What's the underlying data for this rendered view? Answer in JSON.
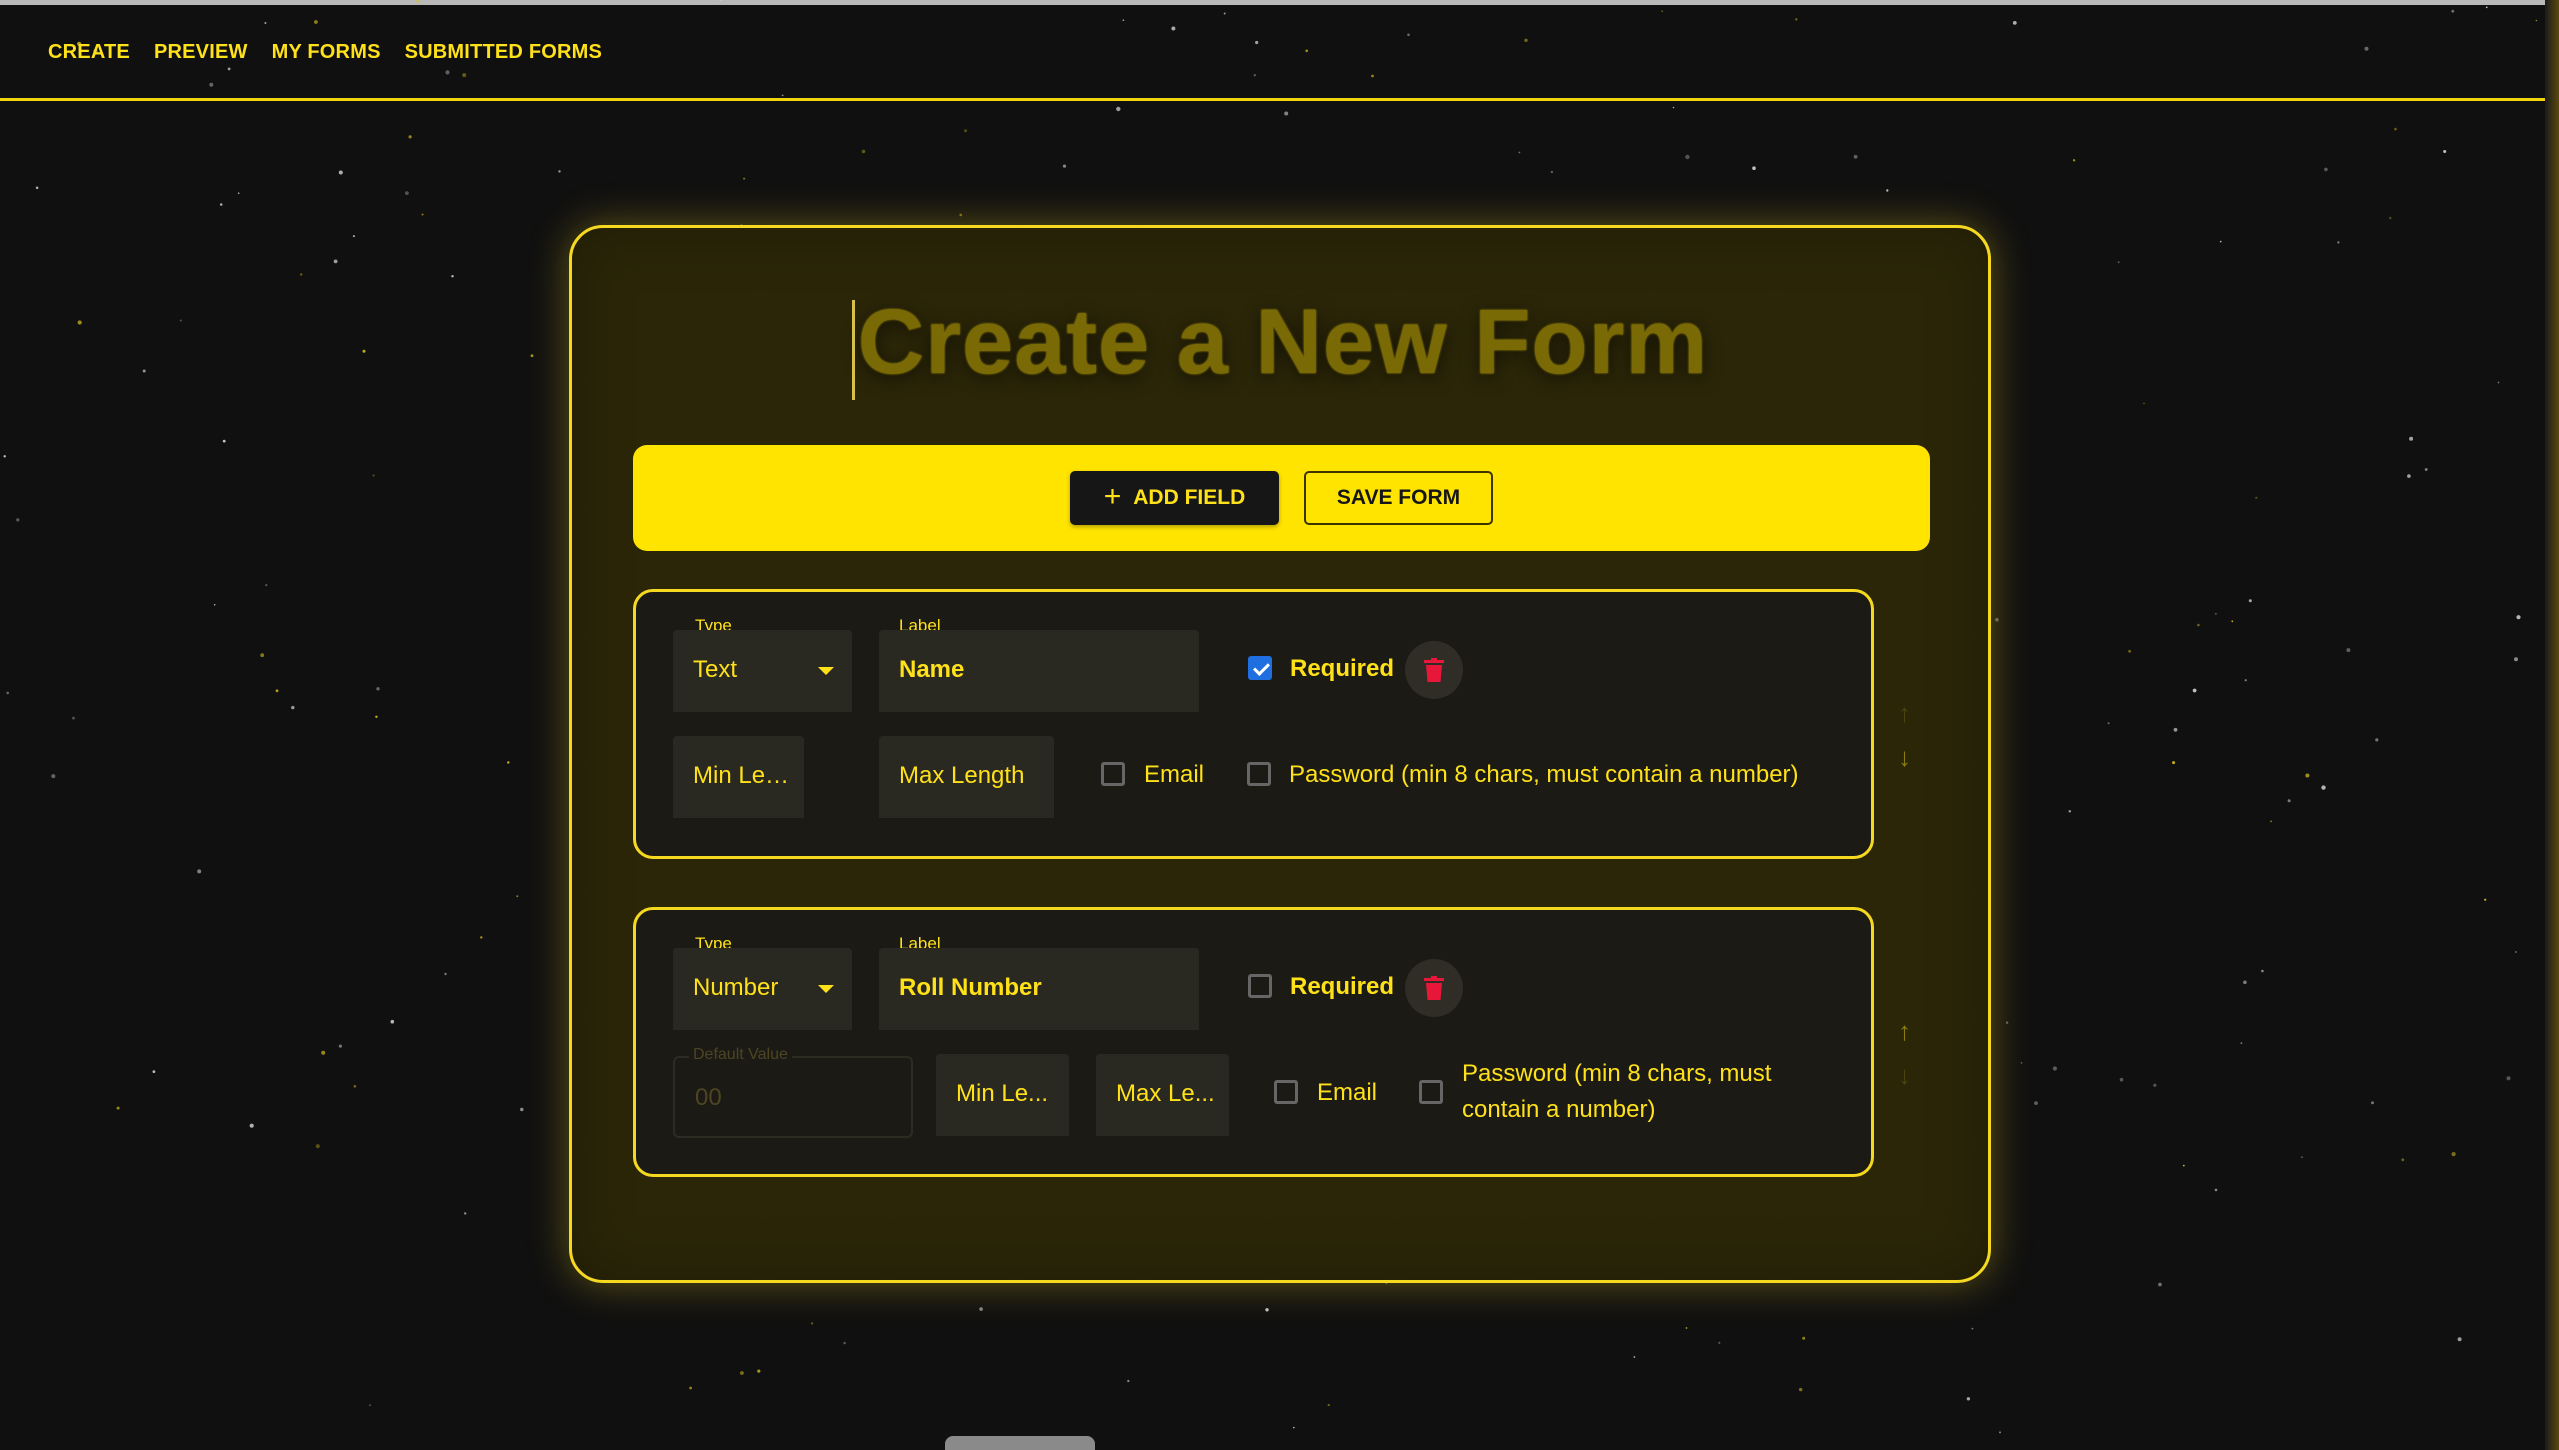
{
  "nav": {
    "items": [
      {
        "label": "CREATE"
      },
      {
        "label": "PREVIEW"
      },
      {
        "label": "MY FORMS"
      },
      {
        "label": "SUBMITTED FORMS"
      }
    ]
  },
  "page": {
    "title": "Create a New Form"
  },
  "toolbar": {
    "add_field_label": "ADD FIELD",
    "save_form_label": "SAVE FORM"
  },
  "fields": [
    {
      "type_label": "Type",
      "type_value": "Text",
      "label_label": "Label",
      "label_value": "Name",
      "required_label": "Required",
      "required_checked": true,
      "min_length_placeholder": "Min Length",
      "max_length_placeholder": "Max Length",
      "email_label": "Email",
      "password_label": "Password (min 8 chars, must contain a number)"
    },
    {
      "type_label": "Type",
      "type_value": "Number",
      "label_label": "Label",
      "label_value": "Roll Number",
      "required_label": "Required",
      "required_checked": false,
      "default_value_label": "Default Value",
      "default_value": "00",
      "min_length_placeholder": "Min Le...",
      "max_length_placeholder": "Max Le...",
      "email_label": "Email",
      "password_label_line1": "Password (min 8 chars, must",
      "password_label_line2": "contain a number)"
    }
  ],
  "colors": {
    "accent": "#ffe11a",
    "toolbar_bg": "#ffe400",
    "background": "#101010",
    "delete": "#e8173a",
    "checkbox_checked": "#1f6fe0"
  },
  "icons": {
    "add": "plus-icon",
    "delete": "trash-icon",
    "move_up": "arrow-up-icon",
    "move_down": "arrow-down-icon",
    "dropdown": "chevron-down-icon"
  }
}
